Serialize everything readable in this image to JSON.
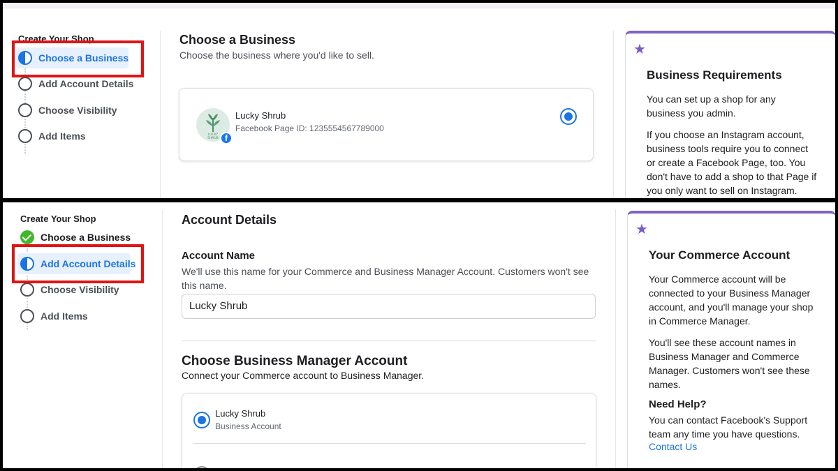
{
  "top": {
    "stepper": {
      "title": "Create Your Shop",
      "steps": [
        "Choose a Business",
        "Add Account Details",
        "Choose Visibility",
        "Add Items"
      ]
    },
    "main": {
      "heading": "Choose a Business",
      "subheading": "Choose the business where you'd like to sell.",
      "business": {
        "name": "Lucky Shrub",
        "page_id": "Facebook Page ID: 1235554567789000",
        "logo_text": "LUCKY SHRUB",
        "selected": true
      }
    },
    "help": {
      "icon": "star-icon",
      "title": "Business Requirements",
      "p1": "You can set up a shop for any business you admin.",
      "p2": "If you choose an Instagram account, business tools require you to connect or create a Facebook Page, too. You don't have to add a shop to that Page if you only want to sell on Instagram."
    }
  },
  "bottom": {
    "stepper": {
      "title": "Create Your Shop",
      "steps": [
        "Choose a Business",
        "Add Account Details",
        "Choose Visibility",
        "Add Items"
      ]
    },
    "main": {
      "heading": "Account Details",
      "account_name_label": "Account Name",
      "account_name_desc": "We'll use this name for your Commerce and Business Manager Account. Customers won't see this name.",
      "account_name_value": "Lucky Shrub",
      "bm_heading": "Choose Business Manager Account",
      "bm_desc": "Connect your Commerce account to Business Manager.",
      "bm_option": {
        "name": "Lucky Shrub",
        "type": "Business Account",
        "selected": true
      }
    },
    "help": {
      "icon": "star-icon",
      "title": "Your Commerce Account",
      "p1": "Your Commerce account will be connected to your Business Manager account, and you'll manage your shop in Commerce Manager.",
      "p2": "You'll see these account names in Business Manager and Commerce Manager. Customers won't see these names.",
      "need_help_title": "Need Help?",
      "need_help_text": "You can contact Facebook's Support team any time you have questions.",
      "contact_link": "Contact Us"
    }
  },
  "colors": {
    "accent_blue": "#1b74e4",
    "highlight_red": "#e01414",
    "help_accent_purple": "#8161c4",
    "success_green": "#42b72a"
  }
}
